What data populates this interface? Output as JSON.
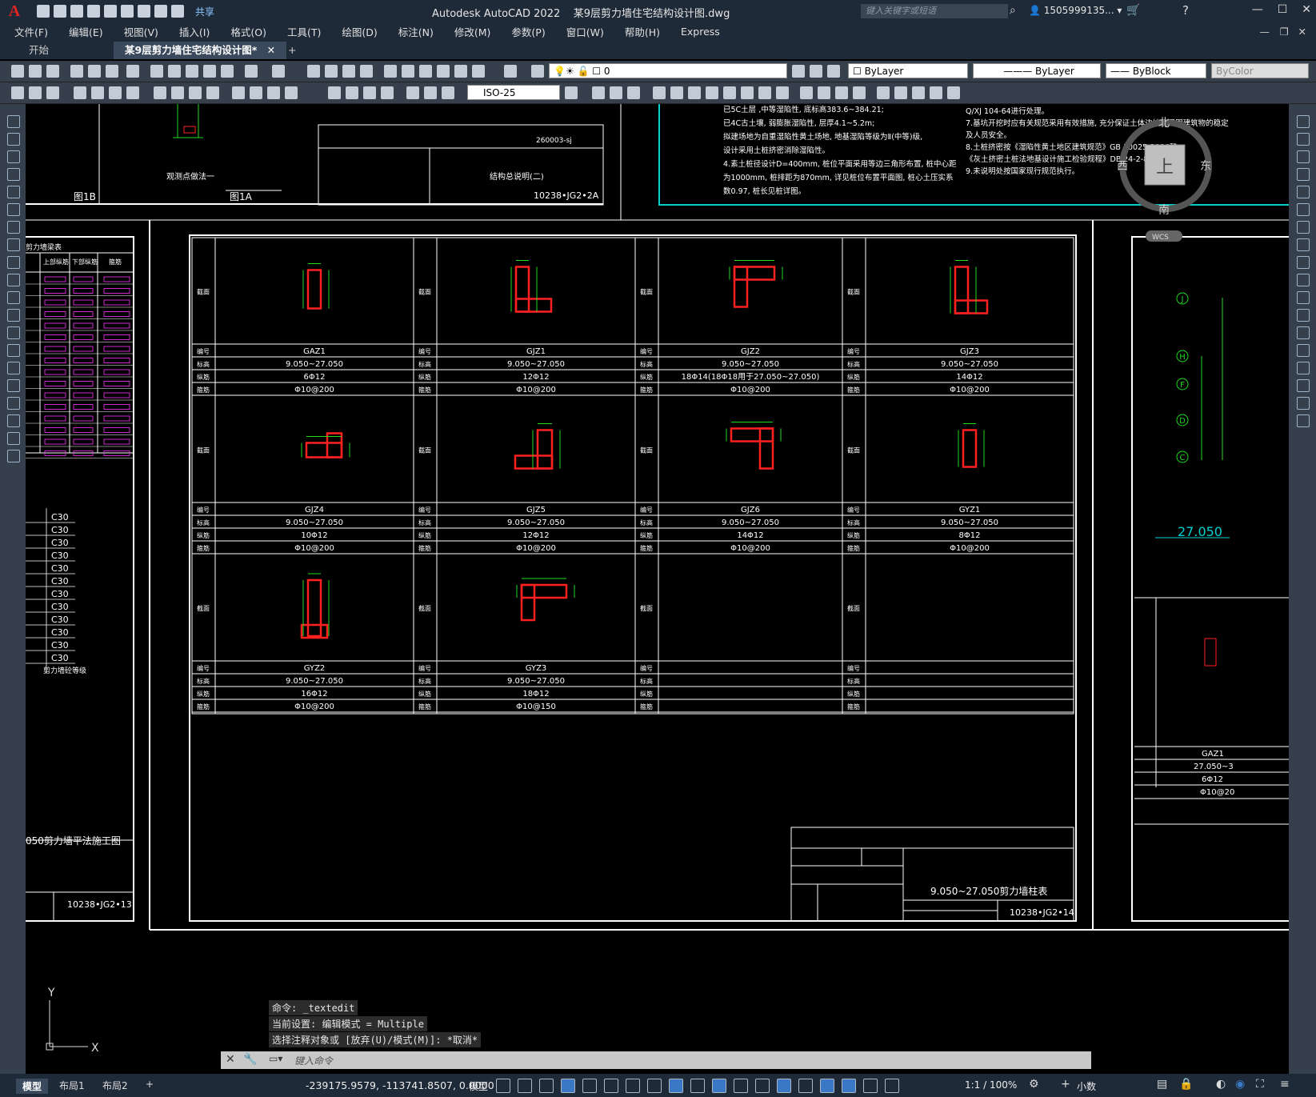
{
  "app": {
    "name": "Autodesk AutoCAD 2022",
    "document": "某9层剪力墙住宅结构设计图.dwg",
    "share": "共享",
    "search_placeholder": "键入关键字或短语",
    "user": "1505999135..."
  },
  "menu": [
    "文件(F)",
    "编辑(E)",
    "视图(V)",
    "插入(I)",
    "格式(O)",
    "工具(T)",
    "绘图(D)",
    "标注(N)",
    "修改(M)",
    "参数(P)",
    "窗口(W)",
    "帮助(H)",
    "Express"
  ],
  "tabs": {
    "start": "开始",
    "doc": "某9层剪力墙住宅结构设计图*"
  },
  "toolbar": {
    "layer": "0",
    "color": "ByLayer",
    "linetype": "ByLayer",
    "lineweight": "ByBlock",
    "plotstyle": "ByColor",
    "dimstyle": "ISO-25"
  },
  "viewcube": {
    "north": "北",
    "south": "南",
    "east": "东",
    "west": "西",
    "face": "上",
    "wcs": "WCS"
  },
  "drawing": {
    "row_labels": [
      "编号",
      "标高",
      "纵筋",
      "箍筋"
    ],
    "section_label": "截面",
    "columns": [
      {
        "id": "GAZ1",
        "elev": "9.050~27.050",
        "long": "6Φ12",
        "stir": "Φ10@200"
      },
      {
        "id": "GJZ1",
        "elev": "9.050~27.050",
        "long": "12Φ12",
        "stir": "Φ10@200"
      },
      {
        "id": "GJZ2",
        "elev": "9.050~27.050",
        "long": "18Φ14(18Φ18用于27.050~27.050)",
        "stir": "Φ10@200"
      },
      {
        "id": "GJZ3",
        "elev": "9.050~27.050",
        "long": "14Φ12",
        "stir": "Φ10@200"
      },
      {
        "id": "GJZ4",
        "elev": "9.050~27.050",
        "long": "10Φ12",
        "stir": "Φ10@200"
      },
      {
        "id": "GJZ5",
        "elev": "9.050~27.050",
        "long": "12Φ12",
        "stir": "Φ10@200"
      },
      {
        "id": "GJZ6",
        "elev": "9.050~27.050",
        "long": "14Φ12",
        "stir": "Φ10@200"
      },
      {
        "id": "GYZ1",
        "elev": "9.050~27.050",
        "long": "8Φ12",
        "stir": "Φ10@200"
      },
      {
        "id": "GYZ2",
        "elev": "9.050~27.050",
        "long": "16Φ12",
        "stir": "Φ10@200"
      },
      {
        "id": "GYZ3",
        "elev": "9.050~27.050",
        "long": "18Φ12",
        "stir": "Φ10@150"
      }
    ],
    "title_block_main": "9.050~27.050剪力墙柱表",
    "title_block_num": "10238•JG2•14",
    "left_title": "050剪力墙平法施工图",
    "left_num": "10238•JG2•13",
    "top_num": "10238•JG2•2A",
    "top_caption": "结构总说明(二)",
    "top_code": "260003-sj",
    "fig1b": "图1B",
    "fig1a": "图1A",
    "detail_caption": "观测点做法一",
    "left_table_title": "剪力墙梁表",
    "left_table_header": [
      "上部纵筋",
      "下部纵筋",
      "箍筋"
    ],
    "concrete": [
      "C30",
      "C30",
      "C30",
      "C30",
      "C30",
      "C30",
      "C30",
      "C30",
      "C30",
      "C30",
      "C30",
      "C30"
    ],
    "concrete_caption": "剪力墙砼等级",
    "right_elev": "27.050",
    "right_col_id": "GAZ1",
    "right_col_elev": "27.050~3",
    "right_col_long": "6Φ12",
    "right_col_stir": "Φ10@20",
    "axis_labels": [
      "J",
      "H",
      "F",
      "D",
      "C"
    ],
    "notes_top": [
      "已5C土层 ,中等湿陷性, 底标高383.6~384.21;",
      "已4C古土壤, 弱膨胀湿陷性, 层厚4.1~5.2m;",
      "拟建场地为自重湿陷性黄土场地, 地基湿陷等级为Ⅱ(中等)级,",
      "设计采用土桩挤密消除湿陷性。",
      "4.素土桩径设计D=400mm, 桩位平面采用等边三角形布置, 桩中心距",
      "为1000mm, 桩排距为870mm, 详见桩位布置平面图, 桩心土压实系",
      "数0.97, 桩长见桩详图。"
    ],
    "notes_right": [
      "Q/XJ 104-64进行处理。",
      "7.基坑开挖时应有关规范采用有效措施, 充分保证土体边坡及周围建筑物的稳定",
      "及人员安全。",
      "8.土桩挤密按《湿陷性黄土地区建筑规范》GB 50025-2004和",
      "《灰土挤密土桩法地基设计施工检验规程》DBJ24-2-85执行。",
      "9.未说明处按国家现行规范执行。"
    ]
  },
  "command": {
    "line1": "命令: _textedit",
    "line2": "当前设置: 编辑模式 = Multiple",
    "line3": "选择注释对象或 [放弃(U)/模式(M)]: *取消*",
    "placeholder": "键入命令"
  },
  "status": {
    "tabs": [
      "模型",
      "布局1",
      "布局2"
    ],
    "coords": "-239175.9579, -113741.8507, 0.0000",
    "mode": "模型",
    "scale": "1:1 / 100%",
    "units": "小数"
  },
  "ucs": {
    "x": "X",
    "y": "Y"
  },
  "colors": {
    "red": "#ff2020",
    "green": "#1fdc1f",
    "cyan": "#00d0d0",
    "magenta": "#ff33ff",
    "white": "#ffffff"
  }
}
